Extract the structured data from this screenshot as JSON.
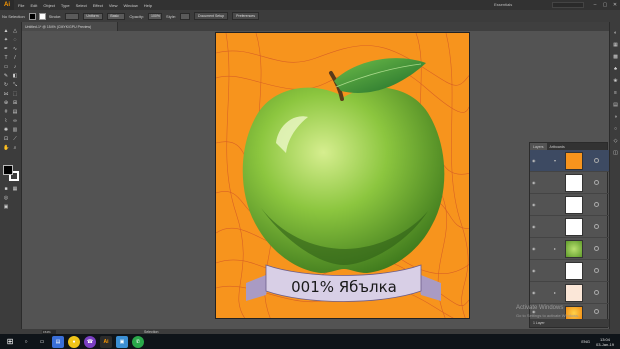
{
  "menubar": {
    "logo": "Ai",
    "items": [
      "File",
      "Edit",
      "Object",
      "Type",
      "Select",
      "Effect",
      "View",
      "Window",
      "Help"
    ],
    "workspace": "Essentials",
    "controls": [
      "–",
      "▢",
      "✕"
    ]
  },
  "controlbar": {
    "selection_label": "No Selection",
    "stroke_label": "Stroke:",
    "uniform_label": "Uniform",
    "basic_label": "Basic",
    "opacity_label": "Opacity:",
    "opacity_value": "100%",
    "style_label": "Style:",
    "doc_setup_button": "Document Setup",
    "preferences_button": "Preferences"
  },
  "document": {
    "tab_title": "Untitled-1* @ 154% (CMYK/GPU Preview)"
  },
  "artwork": {
    "banner_text": "001% Ябълка",
    "colors": {
      "background": "#f7941d",
      "apple": "#8cc63f",
      "leaf": "#2e8b3a",
      "banner": "#d8cfe6"
    }
  },
  "layers_panel": {
    "tabs": [
      "Layers",
      "Artboards"
    ],
    "footer": "1 Layer"
  },
  "statusbar": {
    "zoom": "154%",
    "mode": "Selection"
  },
  "overlay": {
    "activate_title": "Activate Windows",
    "activate_sub": "Go to Settings to activate Windows."
  },
  "taskbar": {
    "lang": "ENG",
    "time": "13:04",
    "date": "03-Jan-19"
  }
}
